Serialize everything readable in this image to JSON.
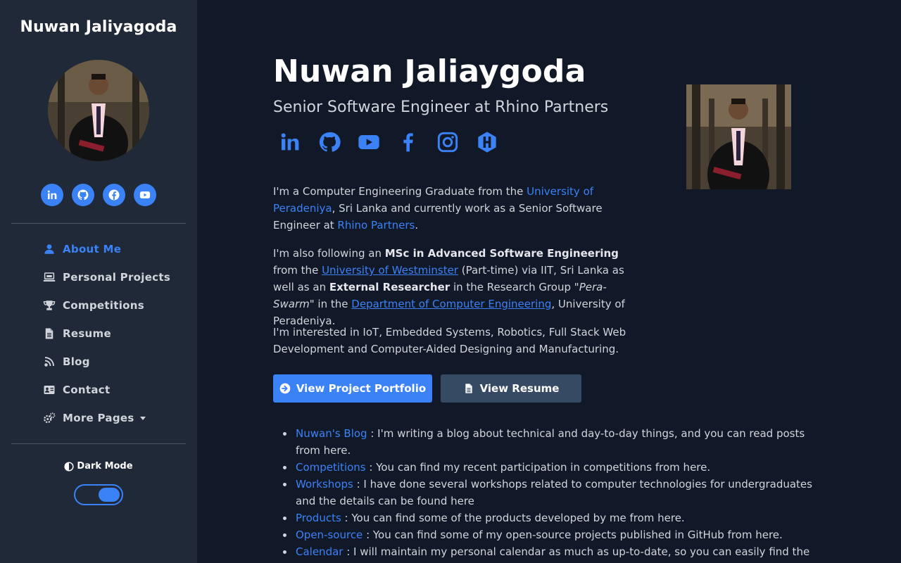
{
  "sidebar": {
    "site_title": "Nuwan Jaliyagoda",
    "social": [
      "linkedin-icon",
      "github-icon",
      "facebook-icon",
      "youtube-icon"
    ],
    "nav": [
      {
        "label": "About Me",
        "icon": "user-icon",
        "active": true
      },
      {
        "label": "Personal Projects",
        "icon": "laptop-icon"
      },
      {
        "label": "Competitions",
        "icon": "trophy-icon"
      },
      {
        "label": "Resume",
        "icon": "file-icon"
      },
      {
        "label": "Blog",
        "icon": "blog-icon"
      },
      {
        "label": "Contact",
        "icon": "contact-card-icon"
      },
      {
        "label": "More Pages",
        "icon": "gears-icon",
        "dropdown": true
      }
    ],
    "dark_mode_label": "Dark Mode",
    "dark_mode_on": true
  },
  "main": {
    "name": "Nuwan Jaliaygoda",
    "subtitle": "Senior Software Engineer at Rhino Partners",
    "social": [
      "linkedin-icon",
      "github-icon",
      "youtube-icon",
      "facebook-icon",
      "instagram-icon",
      "hackster-icon"
    ],
    "p1": {
      "t1": "I'm a Computer Engineering Graduate from the ",
      "link1": "University of Peradeniya",
      "t2": ", Sri Lanka and currently work as a Senior Software Engineer at ",
      "link2": "Rhino Partners",
      "t3": "."
    },
    "p2": {
      "t1": "I'm also following an ",
      "b1": "MSc in Advanced Software Engineering",
      "t2": " from the ",
      "link1": "University of Westminster",
      "t3": " (Part-time) via IIT, Sri Lanka as well as an ",
      "b2": "External Researcher",
      "t4": " in the Research Group \"",
      "i1": "Pera-Swarm",
      "t5": "\" in the ",
      "link2": "Department of Computer Engineering",
      "t6": ", University of Peradeniya."
    },
    "p3": "I'm interested in IoT, Embedded Systems, Robotics, Full Stack Web Development and Computer-Aided Designing and Manufacturing.",
    "btn_portfolio": "View Project Portfolio",
    "btn_resume": "View Resume",
    "links": [
      {
        "label": "Nuwan's Blog",
        "text": " : I'm writing a blog about technical and day-to-day things, and you can read posts from here."
      },
      {
        "label": "Competitions",
        "text": " : You can find my recent participation in competitions from here."
      },
      {
        "label": "Workshops",
        "text": " : I have done several workshops related to computer technologies for undergraduates and the details can be found here"
      },
      {
        "label": "Products",
        "text": " : You can find some of the products developed by me from here."
      },
      {
        "label": "Open-source",
        "text": " : You can find some of my open-source projects published in GitHub from here."
      },
      {
        "label": "Calendar",
        "text": " : I will maintain my personal calendar as much as up-to-date, so you can easily find the best time to reach me."
      }
    ]
  },
  "colors": {
    "accent": "#3b82f6",
    "sidebar_bg": "#1f2937",
    "page_bg": "#111827"
  }
}
